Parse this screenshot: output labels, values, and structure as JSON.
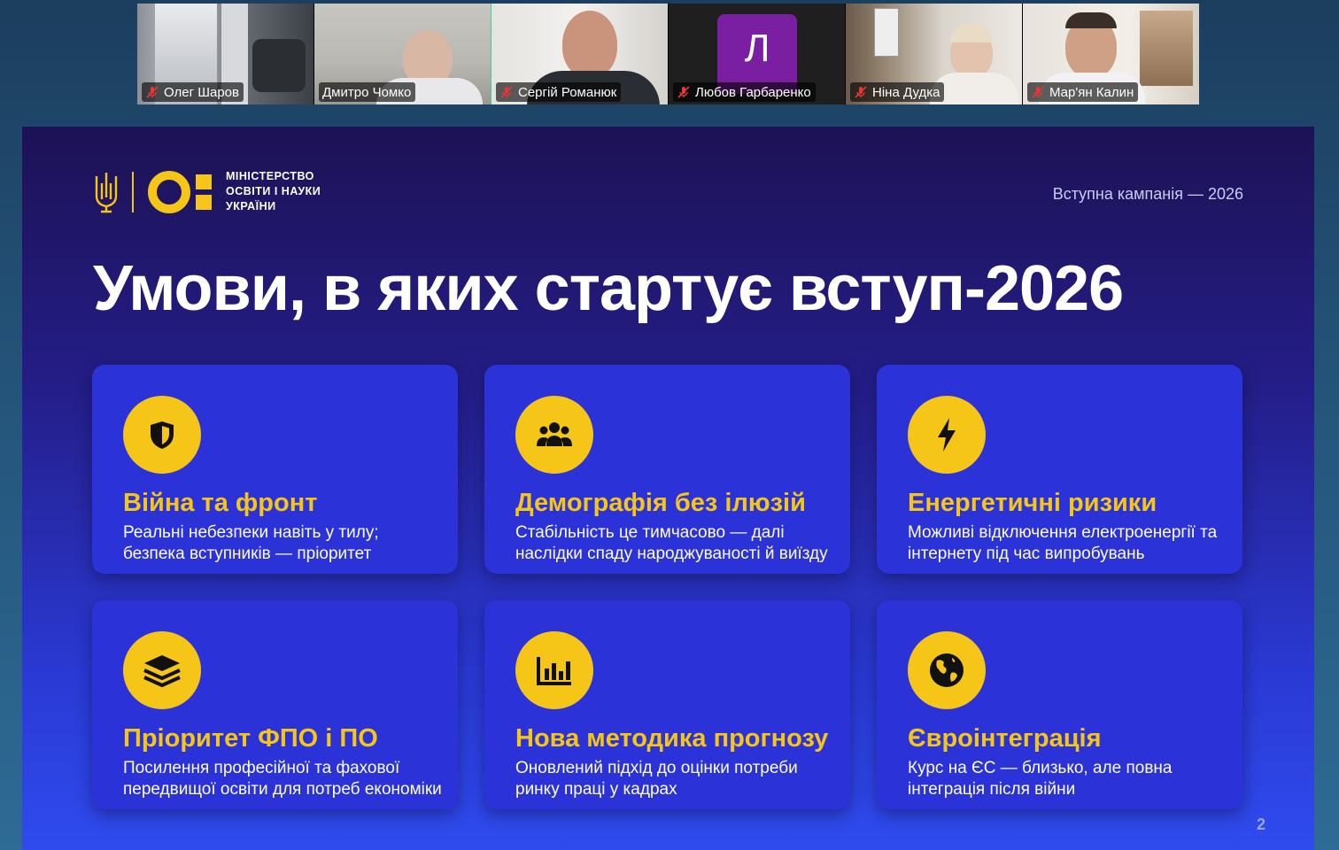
{
  "participants": [
    {
      "name": "Олег Шаров",
      "muted": true,
      "video": "building"
    },
    {
      "name": "Дмитро Чомко",
      "muted": false,
      "active": true,
      "video": "person"
    },
    {
      "name": "Сергій Романюк",
      "muted": true,
      "video": "person"
    },
    {
      "name": "Любов Гарбаренко",
      "muted": true,
      "avatar_letter": "Л"
    },
    {
      "name": "Ніна Дудка",
      "muted": true,
      "video": "person"
    },
    {
      "name": "Мар'ян Калин",
      "muted": true,
      "video": "person"
    }
  ],
  "slide": {
    "logo_text": [
      "МІНІСТЕРСТВО",
      "ОСВІТИ І НАУКИ",
      "УКРАЇНИ"
    ],
    "campaign": "Вступна кампанія — 2026",
    "title": "Умови, в яких стартує вступ-2026",
    "page_number": "2",
    "cards": [
      {
        "icon": "shield-icon",
        "title": "Війна та фронт",
        "desc": "Реальні небезпеки навіть у тилу; безпека вступників — пріоритет"
      },
      {
        "icon": "people-icon",
        "title": "Демографія без ілюзій",
        "desc": "Стабільність це тимчасово — далі наслідки спаду народжуваності й виїзду"
      },
      {
        "icon": "lightning-icon",
        "title": "Енергетичні ризики",
        "desc": "Можливі відключення електроенергії та інтернету під час випробувань"
      },
      {
        "icon": "layers-icon",
        "title": "Пріоритет ФПО і ПО",
        "desc": "Посилення професійної та фахової передвищої освіти для потреб економіки"
      },
      {
        "icon": "bar-chart-icon",
        "title": "Нова методика прогнозу",
        "desc": "Оновлений підхід до оцінки потреби ринку праці у кадрах"
      },
      {
        "icon": "globe-icon",
        "title": "Євроінтеграція",
        "desc": "Курс на ЄС — близько, але повна інтеграція після війни"
      }
    ]
  },
  "colors": {
    "accent_yellow": "#f5c518",
    "card_blue": "#2b33d8",
    "active_speaker": "#37d39a",
    "muted_red": "#e53935"
  }
}
